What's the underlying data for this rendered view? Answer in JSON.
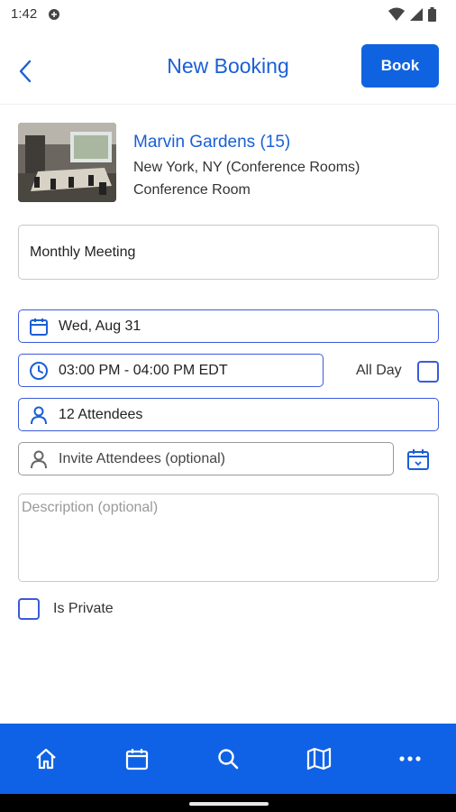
{
  "status_bar": {
    "time": "1:42"
  },
  "app_bar": {
    "title": "New Booking",
    "book_label": "Book"
  },
  "room": {
    "name": "Marvin Gardens (15)",
    "location": "New York, NY (Conference Rooms)",
    "type": "Conference Room"
  },
  "form": {
    "title_value": "Monthly Meeting",
    "date_value": "Wed, Aug 31",
    "time_value": "03:00 PM - 04:00 PM EDT",
    "all_day_label": "All Day",
    "attendees_value": "12 Attendees",
    "invite_placeholder": "Invite Attendees (optional)",
    "description_placeholder": "Description (optional)",
    "private_label": "Is Private"
  },
  "bottom_nav": {
    "items": [
      {
        "icon": "home-icon"
      },
      {
        "icon": "calendar-icon"
      },
      {
        "icon": "search-icon"
      },
      {
        "icon": "map-icon"
      },
      {
        "icon": "more-icon"
      }
    ]
  },
  "colors": {
    "accent": "#1a5fd6",
    "nav_bg": "#0f62e6",
    "field_border": "#3b5bdb"
  }
}
